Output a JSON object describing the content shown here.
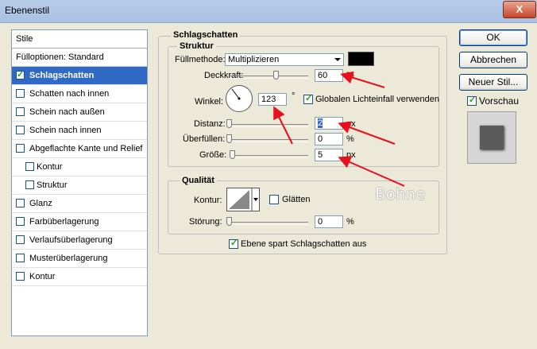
{
  "window": {
    "title": "Ebenenstil",
    "close_label": "X"
  },
  "sidebar": {
    "header": "Stile",
    "fill_options": "Fülloptionen: Standard",
    "items": [
      {
        "label": "Schlagschatten",
        "checked": true
      },
      {
        "label": "Schatten nach innen",
        "checked": false
      },
      {
        "label": "Schein nach außen",
        "checked": false
      },
      {
        "label": "Schein nach innen",
        "checked": false
      },
      {
        "label": "Abgeflachte Kante und Relief",
        "checked": false
      },
      {
        "label": "Kontur",
        "checked": false
      },
      {
        "label": "Struktur",
        "checked": false
      },
      {
        "label": "Glanz",
        "checked": false
      },
      {
        "label": "Farbüberlagerung",
        "checked": false
      },
      {
        "label": "Verlaufsüberlagerung",
        "checked": false
      },
      {
        "label": "Musterüberlagerung",
        "checked": false
      },
      {
        "label": "Kontur",
        "checked": false
      }
    ]
  },
  "panel": {
    "title": "Schlagschatten",
    "structure_title": "Struktur",
    "blend_label": "Füllmethode:",
    "blend_value": "Multiplizieren",
    "shadow_color": "#000000",
    "opacity_label": "Deckkraft:",
    "opacity_value": "60",
    "opacity_unit": "%",
    "angle_label": "Winkel:",
    "angle_value": "123",
    "angle_unit": "°",
    "global_light_label": "Globalen Lichteinfall verwenden",
    "global_light_checked": true,
    "distance_label": "Distanz:",
    "distance_value": "2",
    "distance_unit": "px",
    "spread_label": "Überfüllen:",
    "spread_value": "0",
    "spread_unit": "%",
    "size_label": "Größe:",
    "size_value": "5",
    "size_unit": "px",
    "quality_title": "Qualität",
    "contour_label": "Kontur:",
    "antialias_label": "Glätten",
    "noise_label": "Störung:",
    "noise_value": "0",
    "noise_unit": "%",
    "knockout_label": "Ebene spart Schlagschatten aus",
    "knockout_checked": true,
    "watermark": "Bohne"
  },
  "buttons": {
    "ok": "OK",
    "cancel": "Abbrechen",
    "new_style": "Neuer Stil...",
    "preview_label": "Vorschau",
    "preview_checked": true
  },
  "colors": {
    "selection": "#316ac5",
    "arrow": "#e8101c",
    "preview_swatch": "#5a5a5a"
  }
}
